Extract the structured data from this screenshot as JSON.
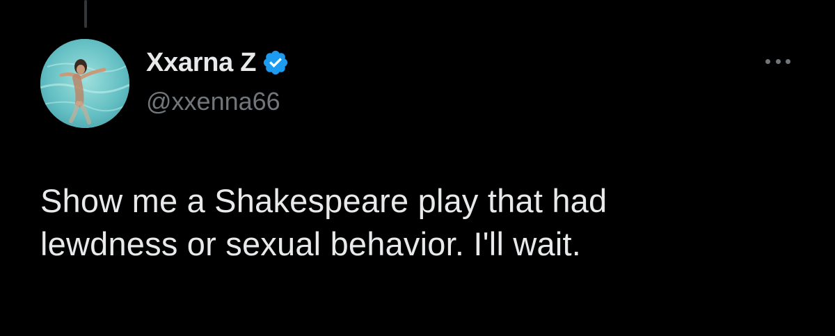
{
  "tweet": {
    "author": {
      "display_name": "Xxarna Z",
      "handle": "@xxenna66",
      "verified": true,
      "avatar_icon": "swimmer-avatar"
    },
    "more_icon": "more-options-icon",
    "text": "Show me a Shakespeare play that had\nlewdness or sexual behavior. I'll wait."
  },
  "colors": {
    "background": "#000000",
    "primary_text": "#e7e9ea",
    "secondary_text": "#71767b",
    "verified_badge": "#1d9bf0",
    "thread_line": "#333639"
  }
}
